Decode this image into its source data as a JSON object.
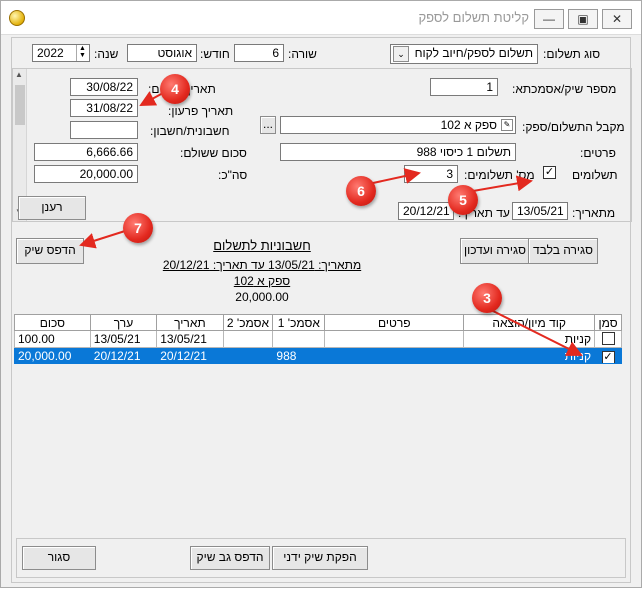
{
  "window": {
    "title": "קליטת תשלום לספק",
    "minimize_label": "—",
    "maximize_label": "▣",
    "close_label": "✕"
  },
  "header": {
    "payment_type_label": "סוג תשלום:",
    "payment_type_value": "תשלום לספק/חיוב לקוח",
    "row_label": "שורה:",
    "row_value": "6",
    "month_label": "חודש:",
    "month_value": "אוגוסט",
    "year_label": "שנה:",
    "year_value": "2022"
  },
  "details": {
    "check_no_label": "מספר שיק/אסמכתא:",
    "check_no_value": "1",
    "reg_date_label": "תאריך רישום:",
    "reg_date_value": "30/08/22",
    "due_date_label": "תאריך פרעון:",
    "due_date_value": "31/08/22",
    "receiver_label": "מקבל התשלום/ספק:",
    "receiver_value": "ספק א   102",
    "invoice_account_label": "חשבונית/חשבון:",
    "invoice_account_value": "",
    "details_label": "פרטים:",
    "details_value": "תשלום 1 כיסוי   988",
    "paid_amount_label": "סכום ששולם:",
    "paid_amount_value": "6,666.66",
    "payments_label": "תשלומים",
    "payments_checked": true,
    "num_payments_label": "מס' תשלומים:",
    "num_payments_value": "3",
    "total_label": "סה\"כ:",
    "total_value": "20,000.00",
    "browse_label": "..."
  },
  "filter": {
    "from_date_label": "מתאריך:",
    "from_date_value": "13/05/21",
    "to_date_label": "עד תאריך:",
    "to_date_value": "20/12/21",
    "refresh_label": "רענן"
  },
  "actions": {
    "print_check_label": "הדפס שיק",
    "close_and_update_label": "סגירה ועדכון",
    "close_only_label": "סגירה בלבד"
  },
  "report": {
    "title": "חשבוניות לתשלום",
    "date_range": "מתאריך: 13/05/21 עד תאריך: 20/12/21",
    "supplier": "ספק א  102",
    "amount": "20,000.00"
  },
  "table": {
    "headers": [
      "סמן",
      "קוד מיון/הוצאה",
      "פרטים",
      "אסמכ' 1",
      "אסמכ' 2",
      "תאריך",
      "ערך",
      "סכום"
    ],
    "rows": [
      {
        "marked": false,
        "code": "קניות",
        "details": "",
        "ref1": "",
        "ref2": "",
        "date": "13/05/21",
        "value_date": "13/05/21",
        "amount": "100.00"
      },
      {
        "marked": true,
        "code": "קניות",
        "details": "",
        "ref1": "988",
        "ref2": "",
        "date": "20/12/21",
        "value_date": "20/12/21",
        "amount": "20,000.00"
      }
    ]
  },
  "footer": {
    "manual_check_label": "הפקת שיק ידני",
    "print_check_back_label": "הדפס גב שיק",
    "close_label": "סגור"
  },
  "annotations": {
    "a3": "3",
    "a4": "4",
    "a5": "5",
    "a6": "6",
    "a7": "7"
  },
  "colors": {
    "selection": "#0a78d7",
    "annotation": "#e3291f"
  }
}
